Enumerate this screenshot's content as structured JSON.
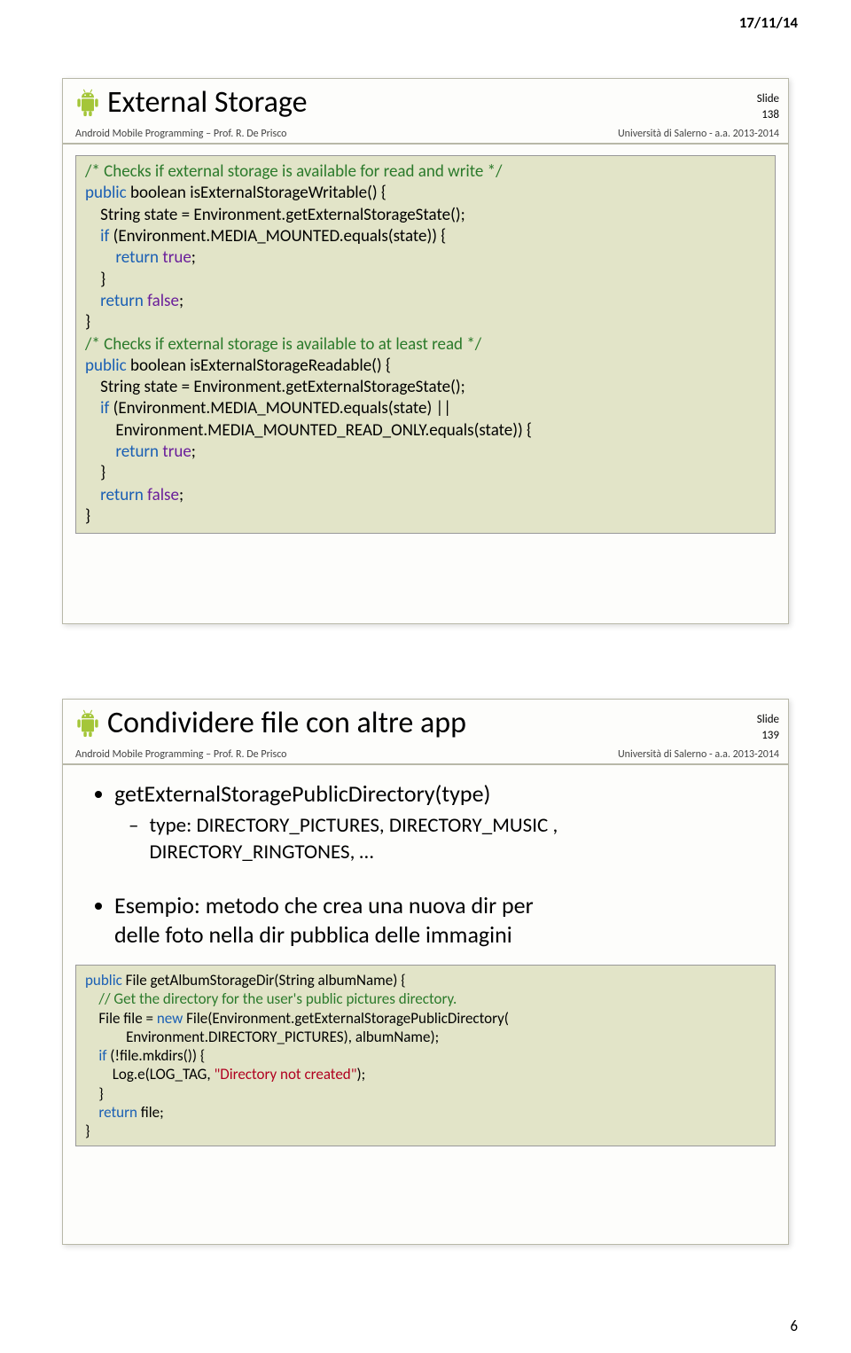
{
  "page_date": "17/11/14",
  "page_number": "6",
  "slide1": {
    "title": "External Storage",
    "meta_slide_label": "Slide",
    "meta_slide_num": "138",
    "meta_left": "Android Mobile Programming – Prof. R. De Prisco",
    "meta_right": "Università di Salerno - a.a. 2013-2014",
    "code": {
      "l1": "/* Checks if external storage is available for read and write */",
      "l2a": "public",
      "l2b": " boolean isExternalStorageWritable() {",
      "l3": "    String state = Environment.getExternalStorageState();",
      "l4a": "    if",
      "l4b": " (Environment.MEDIA_MOUNTED.equals(state)) {",
      "l5a": "        return",
      "l5b": " true",
      "l5c": ";",
      "l6": "    }",
      "l7a": "    return",
      "l7b": " false",
      "l7c": ";",
      "l8": "}",
      "l9": "/* Checks if external storage is available to at least read */",
      "l10a": "public",
      "l10b": " boolean isExternalStorageReadable() {",
      "l11": "    String state = Environment.getExternalStorageState();",
      "l12a": "    if",
      "l12b": " (Environment.MEDIA_MOUNTED.equals(state) ||",
      "l13": "        Environment.MEDIA_MOUNTED_READ_ONLY.equals(state)) {",
      "l14a": "        return",
      "l14b": " true",
      "l14c": ";",
      "l15": "    }",
      "l16a": "    return",
      "l16b": " false",
      "l16c": ";",
      "l17": "}"
    }
  },
  "slide2": {
    "title": "Condividere file con altre app",
    "meta_slide_label": "Slide",
    "meta_slide_num": "139",
    "meta_left": "Android Mobile Programming – Prof. R. De Prisco",
    "meta_right": "Università di Salerno - a.a. 2013-2014",
    "bullets": {
      "b1_1": "getExternalStoragePublicDirectory(type)",
      "b2_1a": "type: DIRECTORY_PICTURES, DIRECTORY_MUSIC ,",
      "b2_1b": "DIRECTORY_RINGTONES, …",
      "b1_2a": "Esempio: metodo che crea una nuova dir per",
      "b1_2b": "delle foto nella dir pubblica delle immagini"
    },
    "code": {
      "l1a": "public",
      "l1b": " File getAlbumStorageDir(String albumName) {",
      "l2": "    // Get the directory for the user's public pictures directory.",
      "l3a": "    File file = ",
      "l3b": "new",
      "l3c": " File(Environment.getExternalStoragePublicDirectory(",
      "l4": "            Environment.DIRECTORY_PICTURES), albumName);",
      "l5a": "    if",
      "l5b": " (!file.mkdirs()) {",
      "l6a": "        Log.e(LOG_TAG, ",
      "l6b": "\"Directory not created\"",
      "l6c": ");",
      "l7": "    }",
      "l8a": "    return",
      "l8b": " file;",
      "l9": "}"
    }
  }
}
